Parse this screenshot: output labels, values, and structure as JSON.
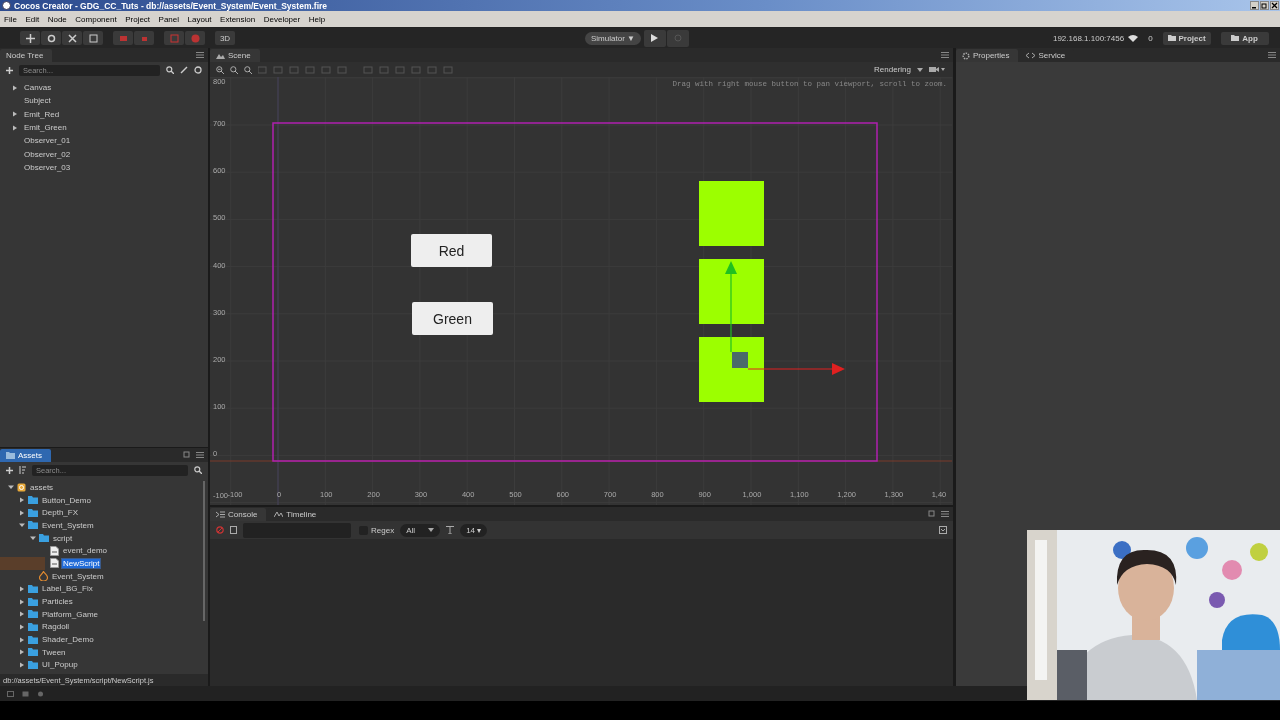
{
  "window": {
    "title": "Cocos Creator - GDG_CC_Tuts - db://assets/Event_System/Event_System.fire"
  },
  "menu": [
    "File",
    "Edit",
    "Node",
    "Component",
    "Project",
    "Panel",
    "Layout",
    "Extension",
    "Developer",
    "Help"
  ],
  "toolbar": {
    "mode_3d": "3D",
    "simulator": "Simulator ▼",
    "ip": "192.168.1.100:7456",
    "connections": "0",
    "project": "Project",
    "app": "App"
  },
  "node_tree": {
    "title": "Node Tree",
    "search": {
      "placeholder": "Search..."
    },
    "nodes": [
      {
        "label": "Canvas",
        "has_children": true
      },
      {
        "label": "Subject",
        "has_children": false
      },
      {
        "label": "Emit_Red",
        "has_children": true
      },
      {
        "label": "Emit_Green",
        "has_children": true
      },
      {
        "label": "Observer_01",
        "has_children": false
      },
      {
        "label": "Observer_02",
        "has_children": false
      },
      {
        "label": "Observer_03",
        "has_children": false
      }
    ]
  },
  "scene": {
    "title": "Scene",
    "rendering": "Rendering",
    "hint": "Drag with right mouse button to pan viewport, scroll to zoom.",
    "y_labels": [
      "800",
      "700",
      "600",
      "500",
      "400",
      "300",
      "200",
      "100",
      "0",
      "-100"
    ],
    "x_labels": [
      "-100",
      "0",
      "100",
      "200",
      "300",
      "400",
      "500",
      "600",
      "700",
      "800",
      "900",
      "1,000",
      "1,100",
      "1,200",
      "1,300",
      "1,40"
    ],
    "buttons": [
      "Red",
      "Green"
    ]
  },
  "console": {
    "tabs": [
      {
        "label": "Console",
        "selected": true
      },
      {
        "label": "Timeline",
        "selected": false
      }
    ],
    "regex": {
      "label": "Regex",
      "checked": false
    },
    "level": "All",
    "font_size": "14 ▾"
  },
  "properties": {
    "tabs": [
      {
        "label": "Properties",
        "selected": true
      },
      {
        "label": "Service",
        "selected": false
      }
    ]
  },
  "assets": {
    "title": "Assets",
    "search": {
      "placeholder": "Search..."
    },
    "tree": [
      {
        "label": "assets",
        "kind": "root",
        "expanded": true,
        "selected": false,
        "children": [
          {
            "label": "Button_Demo",
            "kind": "folder",
            "expanded": false,
            "selected": false
          },
          {
            "label": "Depth_FX",
            "kind": "folder",
            "expanded": false,
            "selected": false
          },
          {
            "label": "Event_System",
            "kind": "folder",
            "expanded": true,
            "selected": false,
            "children": [
              {
                "label": "script",
                "kind": "folder",
                "expanded": true,
                "selected": false,
                "children": [
                  {
                    "label": "event_demo",
                    "kind": "script",
                    "selected": false
                  },
                  {
                    "label": "NewScript",
                    "kind": "script",
                    "selected": true
                  }
                ]
              },
              {
                "label": "Event_System",
                "kind": "scene",
                "selected": false
              }
            ]
          },
          {
            "label": "Label_BG_Fix",
            "kind": "folder",
            "expanded": false,
            "selected": false
          },
          {
            "label": "Particles",
            "kind": "folder",
            "expanded": false,
            "selected": false
          },
          {
            "label": "Platform_Game",
            "kind": "folder",
            "expanded": false,
            "selected": false
          },
          {
            "label": "Ragdoll",
            "kind": "folder",
            "expanded": false,
            "selected": false
          },
          {
            "label": "Shader_Demo",
            "kind": "folder",
            "expanded": false,
            "selected": false
          },
          {
            "label": "Tween",
            "kind": "folder",
            "expanded": false,
            "selected": false
          },
          {
            "label": "UI_Popup",
            "kind": "folder",
            "expanded": false,
            "selected": false
          }
        ]
      }
    ]
  },
  "status_path": "db://assets/Event_System/script/NewScript.js"
}
